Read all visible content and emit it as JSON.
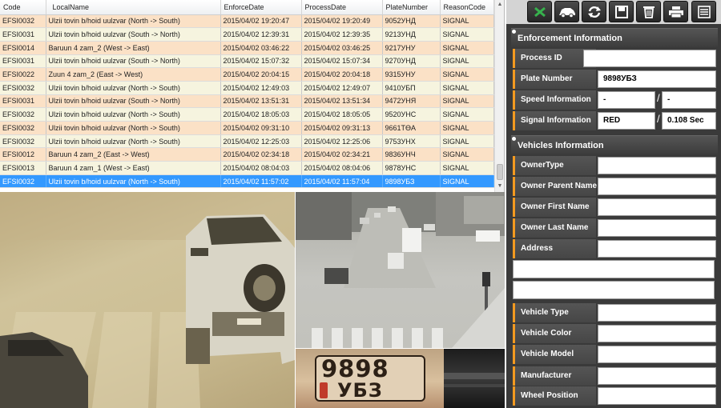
{
  "table": {
    "headers": [
      "Code",
      "LocalName",
      "EnforceDate",
      "ProcessDate",
      "PlateNumber",
      "ReasonCode"
    ],
    "rows": [
      {
        "code": "EFSI0032",
        "name": "Ulzii tovin b/hoid uulzvar (North -> South)",
        "enforce": "2015/04/02 19:20:47",
        "process": "2015/04/02 19:20:49",
        "plate": "9052УНД",
        "reason": "SIGNAL"
      },
      {
        "code": "EFSI0031",
        "name": "Ulzii tovin b/hoid uulzvar (South -> North)",
        "enforce": "2015/04/02 12:39:31",
        "process": "2015/04/02 12:39:35",
        "plate": "9213УНД",
        "reason": "SIGNAL"
      },
      {
        "code": "EFSI0014",
        "name": "Baruun 4 zam_2 (West -> East)",
        "enforce": "2015/04/02 03:46:22",
        "process": "2015/04/02 03:46:25",
        "plate": "9217УНУ",
        "reason": "SIGNAL"
      },
      {
        "code": "EFSI0031",
        "name": "Ulzii tovin b/hoid uulzvar (South -> North)",
        "enforce": "2015/04/02 15:07:32",
        "process": "2015/04/02 15:07:34",
        "plate": "9270УНД",
        "reason": "SIGNAL"
      },
      {
        "code": "EFSI0022",
        "name": "Zuun 4 zam_2 (East -> West)",
        "enforce": "2015/04/02 20:04:15",
        "process": "2015/04/02 20:04:18",
        "plate": "9315УНУ",
        "reason": "SIGNAL"
      },
      {
        "code": "EFSI0032",
        "name": "Ulzii tovin b/hoid uulzvar (North -> South)",
        "enforce": "2015/04/02 12:49:03",
        "process": "2015/04/02 12:49:07",
        "plate": "9410УБП",
        "reason": "SIGNAL"
      },
      {
        "code": "EFSI0031",
        "name": "Ulzii tovin b/hoid uulzvar (South -> North)",
        "enforce": "2015/04/02 13:51:31",
        "process": "2015/04/02 13:51:34",
        "plate": "9472УНЯ",
        "reason": "SIGNAL"
      },
      {
        "code": "EFSI0032",
        "name": "Ulzii tovin b/hoid uulzvar (North -> South)",
        "enforce": "2015/04/02 18:05:03",
        "process": "2015/04/02 18:05:05",
        "plate": "9520УНС",
        "reason": "SIGNAL"
      },
      {
        "code": "EFSI0032",
        "name": "Ulzii tovin b/hoid uulzvar (North -> South)",
        "enforce": "2015/04/02 09:31:10",
        "process": "2015/04/02 09:31:13",
        "plate": "9661ТӨА",
        "reason": "SIGNAL"
      },
      {
        "code": "EFSI0032",
        "name": "Ulzii tovin b/hoid uulzvar (North -> South)",
        "enforce": "2015/04/02 12:25:03",
        "process": "2015/04/02 12:25:06",
        "plate": "9753УНХ",
        "reason": "SIGNAL"
      },
      {
        "code": "EFSI0012",
        "name": "Baruun 4 zam_2 (East -> West)",
        "enforce": "2015/04/02 02:34:18",
        "process": "2015/04/02 02:34:21",
        "plate": "9836УНЧ",
        "reason": "SIGNAL"
      },
      {
        "code": "EFSI0013",
        "name": "Baruun 4 zam_1 (West -> East)",
        "enforce": "2015/04/02 08:04:03",
        "process": "2015/04/02 08:04:06",
        "plate": "9878УНС",
        "reason": "SIGNAL"
      },
      {
        "code": "EFSI0032",
        "name": "Ulzii tovin b/hoid uulzvar (North -> South)",
        "enforce": "2015/04/02 11:57:02",
        "process": "2015/04/02 11:57:04",
        "plate": "9898УБЗ",
        "reason": "SIGNAL"
      }
    ],
    "selected_row": 12
  },
  "plate_image": {
    "line1": "9898",
    "line2": "УБЗ"
  },
  "toolbar": {
    "icons": [
      "excel-export-icon",
      "car-icon",
      "refresh-icon",
      "save-icon",
      "delete-icon",
      "print-icon",
      "list-icon"
    ]
  },
  "enforcement": {
    "title": "Enforcement Information",
    "process_id_label": "Process ID",
    "process_id": "",
    "plate_number_label": "Plate Number",
    "plate_number": "9898УБЗ",
    "speed_label": "Speed Information",
    "speed_a": "-",
    "speed_b": "-",
    "signal_label": "Signal Information",
    "signal_state": "RED",
    "signal_time": "0.108 Sec"
  },
  "vehicles": {
    "title": "Vehicles Information",
    "owner_type_label": "OwnerType",
    "owner_parent_label": "Owner Parent Name",
    "owner_first_label": "Owner First Name",
    "owner_last_label": "Owner Last Name",
    "address_label": "Address",
    "vehicle_type_label": "Vehicle Type",
    "vehicle_color_label": "Vehicle Color",
    "vehicle_model_label": "Vehicle Model",
    "manufacturer_label": "Manufacturer",
    "wheel_position_label": "Wheel Position"
  },
  "colors": {
    "accent": "#f39a20",
    "selection": "#3399ff",
    "row_orange": "#fbe1c6",
    "row_cream": "#f6f4df",
    "panel_bg": "#3a3a3a"
  }
}
